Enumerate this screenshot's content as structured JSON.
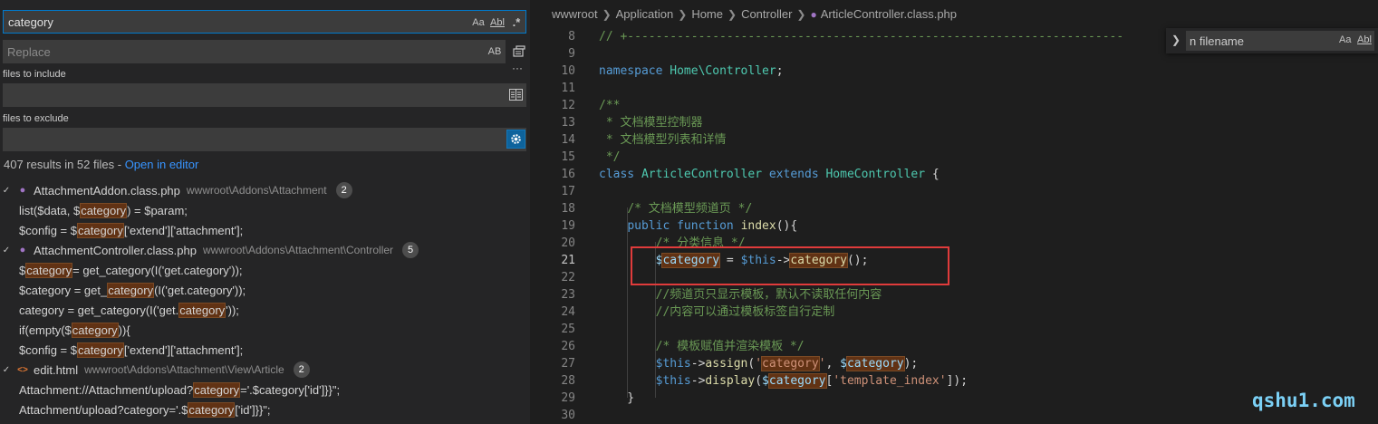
{
  "search_panel": {
    "search_value": "category",
    "search_options": {
      "match_case": "Aa",
      "whole_word": "Abl",
      "regex": ".*"
    },
    "replace_placeholder": "Replace",
    "replace_option": "AB",
    "files_to_include_label": "files to include",
    "files_to_exclude_label": "files to exclude",
    "more_label": "···",
    "summary_text": "407 results in 52 files - ",
    "open_in_editor": "Open in editor",
    "results": [
      {
        "file": "AttachmentAddon.class.php",
        "path": "wwwroot\\Addons\\Attachment",
        "count": "2",
        "icon": "php-elephant-icon",
        "matches": [
          {
            "pre": "list($data, $",
            "hit": "category",
            "post": ") = $param;"
          },
          {
            "pre": "$config = $",
            "hit": "category",
            "post": "['extend']['attachment'];"
          }
        ]
      },
      {
        "file": "AttachmentController.class.php",
        "path": "wwwroot\\Addons\\Attachment\\Controller",
        "count": "5",
        "icon": "php-elephant-icon",
        "matches": [
          {
            "pre": "$",
            "hit": "category",
            "post": " = get_category(I('get.category'));"
          },
          {
            "pre": "$category = get_",
            "hit": "category",
            "post": "(I('get.category'));"
          },
          {
            "pre": "category = get_category(I('get.",
            "hit": "category",
            "post": "'));"
          },
          {
            "pre": "if(empty($",
            "hit": "category",
            "post": ")){"
          },
          {
            "pre": "$config = $",
            "hit": "category",
            "post": "['extend']['attachment'];"
          }
        ]
      },
      {
        "file": "edit.html",
        "path": "wwwroot\\Addons\\Attachment\\View\\Article",
        "count": "2",
        "icon": "html-brackets-icon",
        "matches": [
          {
            "pre": "Attachment://Attachment/upload?",
            "hit": "category",
            "post": "='.$category['id']}}\";"
          },
          {
            "pre": "Attachment/upload?category='.$",
            "hit": "category",
            "post": "['id']}}\";"
          }
        ]
      }
    ]
  },
  "editor": {
    "breadcrumb": [
      "wwwroot",
      "Application",
      "Home",
      "Controller",
      "ArticleController.class.php"
    ],
    "current_line": "21",
    "lines": [
      {
        "n": "8",
        "tokens": [
          {
            "c": "c-com",
            "t": "// +----------------------------------------------------------------------"
          }
        ]
      },
      {
        "n": "9",
        "tokens": []
      },
      {
        "n": "10",
        "tokens": [
          {
            "c": "c-kw",
            "t": "namespace"
          },
          {
            "c": "",
            "t": " "
          },
          {
            "c": "c-cls",
            "t": "Home\\Controller"
          },
          {
            "c": "",
            "t": ";"
          }
        ]
      },
      {
        "n": "11",
        "tokens": []
      },
      {
        "n": "12",
        "tokens": [
          {
            "c": "c-com",
            "t": "/**"
          }
        ]
      },
      {
        "n": "13",
        "tokens": [
          {
            "c": "c-com",
            "t": " * 文档模型控制器"
          }
        ]
      },
      {
        "n": "14",
        "tokens": [
          {
            "c": "c-com",
            "t": " * 文档模型列表和详情"
          }
        ]
      },
      {
        "n": "15",
        "tokens": [
          {
            "c": "c-com",
            "t": " */"
          }
        ]
      },
      {
        "n": "16",
        "tokens": [
          {
            "c": "c-kw",
            "t": "class"
          },
          {
            "c": "",
            "t": " "
          },
          {
            "c": "c-cls",
            "t": "ArticleController"
          },
          {
            "c": "",
            "t": " "
          },
          {
            "c": "c-kw",
            "t": "extends"
          },
          {
            "c": "",
            "t": " "
          },
          {
            "c": "c-cls",
            "t": "HomeController"
          },
          {
            "c": "",
            "t": " {"
          }
        ]
      },
      {
        "n": "17",
        "tokens": []
      },
      {
        "n": "18",
        "tokens": [
          {
            "c": "",
            "t": "    "
          },
          {
            "c": "c-com",
            "t": "/* 文档模型频道页 */"
          }
        ]
      },
      {
        "n": "19",
        "tokens": [
          {
            "c": "",
            "t": "    "
          },
          {
            "c": "c-kw",
            "t": "public"
          },
          {
            "c": "",
            "t": " "
          },
          {
            "c": "c-kw",
            "t": "function"
          },
          {
            "c": "",
            "t": " "
          },
          {
            "c": "c-fn",
            "t": "index"
          },
          {
            "c": "",
            "t": "(){"
          }
        ]
      },
      {
        "n": "20",
        "tokens": [
          {
            "c": "",
            "t": "        "
          },
          {
            "c": "c-com",
            "t": "/* 分类信息 */"
          }
        ]
      },
      {
        "n": "21",
        "tokens": [
          {
            "c": "",
            "t": "        "
          },
          {
            "c": "c-var",
            "t": "$"
          },
          {
            "c": "c-var cm",
            "t": "category"
          },
          {
            "c": "",
            "t": " = "
          },
          {
            "c": "c-thi",
            "t": "$this"
          },
          {
            "c": "",
            "t": "->"
          },
          {
            "c": "c-fn cm",
            "t": "category"
          },
          {
            "c": "",
            "t": "();"
          }
        ]
      },
      {
        "n": "22",
        "tokens": []
      },
      {
        "n": "23",
        "tokens": [
          {
            "c": "",
            "t": "        "
          },
          {
            "c": "c-com",
            "t": "//频道页只显示模板，默认不读取任何内容"
          }
        ]
      },
      {
        "n": "24",
        "tokens": [
          {
            "c": "",
            "t": "        "
          },
          {
            "c": "c-com",
            "t": "//内容可以通过模板标签自行定制"
          }
        ]
      },
      {
        "n": "25",
        "tokens": []
      },
      {
        "n": "26",
        "tokens": [
          {
            "c": "",
            "t": "        "
          },
          {
            "c": "c-com",
            "t": "/* 模板赋值并渲染模板 */"
          }
        ]
      },
      {
        "n": "27",
        "tokens": [
          {
            "c": "",
            "t": "        "
          },
          {
            "c": "c-thi",
            "t": "$this"
          },
          {
            "c": "",
            "t": "->"
          },
          {
            "c": "c-fn",
            "t": "assign"
          },
          {
            "c": "",
            "t": "("
          },
          {
            "c": "c-str",
            "t": "'"
          },
          {
            "c": "c-str cm",
            "t": "category"
          },
          {
            "c": "c-str",
            "t": "'"
          },
          {
            "c": "",
            "t": ", "
          },
          {
            "c": "c-var",
            "t": "$"
          },
          {
            "c": "c-var cm",
            "t": "category"
          },
          {
            "c": "",
            "t": ");"
          }
        ]
      },
      {
        "n": "28",
        "tokens": [
          {
            "c": "",
            "t": "        "
          },
          {
            "c": "c-thi",
            "t": "$this"
          },
          {
            "c": "",
            "t": "->"
          },
          {
            "c": "c-fn",
            "t": "display"
          },
          {
            "c": "",
            "t": "("
          },
          {
            "c": "c-var",
            "t": "$"
          },
          {
            "c": "c-var cm",
            "t": "category"
          },
          {
            "c": "",
            "t": "["
          },
          {
            "c": "c-str",
            "t": "'template_index'"
          },
          {
            "c": "",
            "t": "]);"
          }
        ]
      },
      {
        "n": "29",
        "tokens": [
          {
            "c": "",
            "t": "    }"
          }
        ]
      },
      {
        "n": "30",
        "tokens": []
      }
    ],
    "find_widget": {
      "value": "n filename",
      "match_case": "Aa",
      "whole_word": "Abl"
    }
  },
  "watermark": "qshu1.com",
  "colors": {
    "accent": "#007acc",
    "match_highlight": "#613214",
    "annotation_box": "#e03b3b"
  }
}
